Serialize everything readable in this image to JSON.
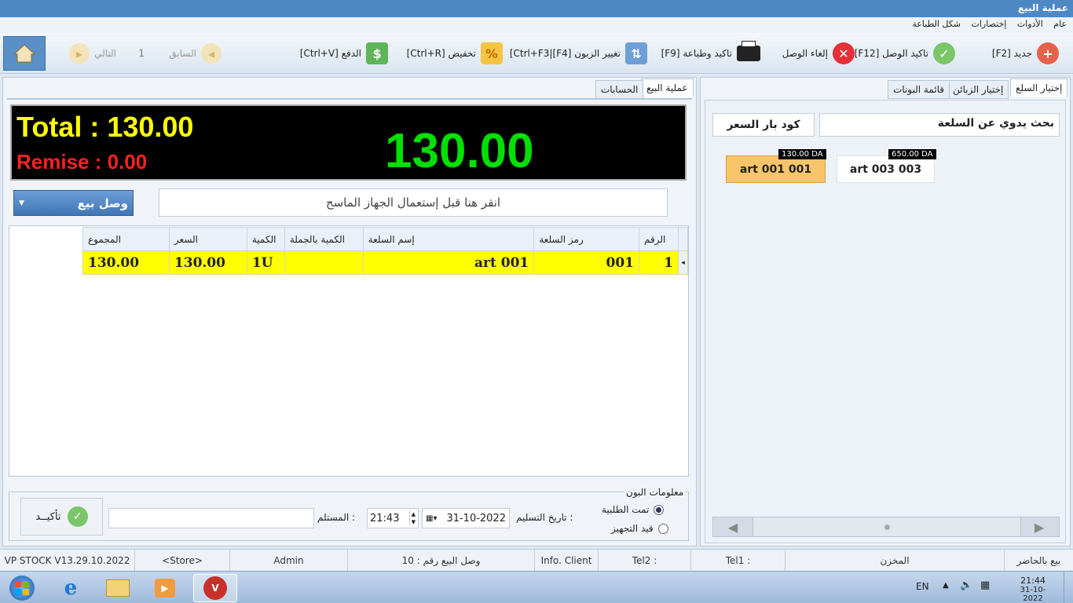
{
  "window": {
    "title": "عملية البيع"
  },
  "menu": [
    "عام",
    "الأدوات",
    "إختصارات",
    "شكل الطباعة"
  ],
  "toolbar": {
    "new": "جديد [F2]",
    "confirm_receipt": "تاكيد الوصل [F12]",
    "cancel_receipt": "إلغاء الوصل",
    "confirm_print": "تاكيد وطباعة [F9]",
    "change_client": "تغيير الزبون [F4]|Ctrl+F3]",
    "discount": "تخفيض [Ctrl+R]",
    "payment": "الدفع [Ctrl+V]",
    "previous": "السابق",
    "page": "1",
    "next": "التالي"
  },
  "left_tabs": {
    "sale": "عملية البيع",
    "accounts": "الحسابات"
  },
  "right_tabs": {
    "items": "إختيار السلع",
    "clients": "إختيار الزبائن",
    "receipts": "قائمة البونات"
  },
  "display": {
    "total": "Total : 130.00",
    "remise": "Remise : 0.00",
    "big": "130.00"
  },
  "sale_type": "وصل بيع",
  "scanner_hint": "انقر هنا قبل إستعمال الجهاز الماسح",
  "grid": {
    "headers": [
      "الرقم",
      "رمز السلعة",
      "إسم السلعة",
      "الكمية بالجملة",
      "الكمية",
      "السعر",
      "المجموع"
    ],
    "rows": [
      [
        "1",
        "001",
        "art 001",
        "",
        "1U",
        "130.00",
        "130.00"
      ]
    ]
  },
  "order_info": {
    "legend": "معلومات البون",
    "done": "تمت الطلبية",
    "preparing": "قيد التجهيز",
    "delivery_label": "تاريخ التسليم :",
    "date": "31-10-2022",
    "time": "21:43",
    "receiver_label": "المستلم :",
    "receiver_value": "",
    "confirm": "تأكيــد"
  },
  "search": {
    "manual": "بحث يدوي عن السلعة",
    "barcode": "كود بار السعر"
  },
  "products": [
    {
      "name": "art 001 001",
      "price": "130.00 DA",
      "selected": true
    },
    {
      "name": "art 003 003",
      "price": "650.00 DA",
      "selected": false
    }
  ],
  "status": {
    "version": "VP STOCK V13.29.10.2022",
    "store": "<Store>",
    "user": "Admin",
    "sale_no": "وصل البيع رقم : 10",
    "info_client": "Info. Client",
    "tel2": "Tel2 :",
    "tel1": "Tel1 :",
    "warehouse": "المخزن",
    "cash_sale": "بيع بالحاضر"
  },
  "taskbar": {
    "lang": "EN",
    "time": "21:44",
    "date": "31-10-2022"
  },
  "colors": {
    "accent": "#4d88c5",
    "highlight": "#ffff00",
    "total": "#ffff00",
    "remise": "#ff0000",
    "big": "#00ff00"
  }
}
